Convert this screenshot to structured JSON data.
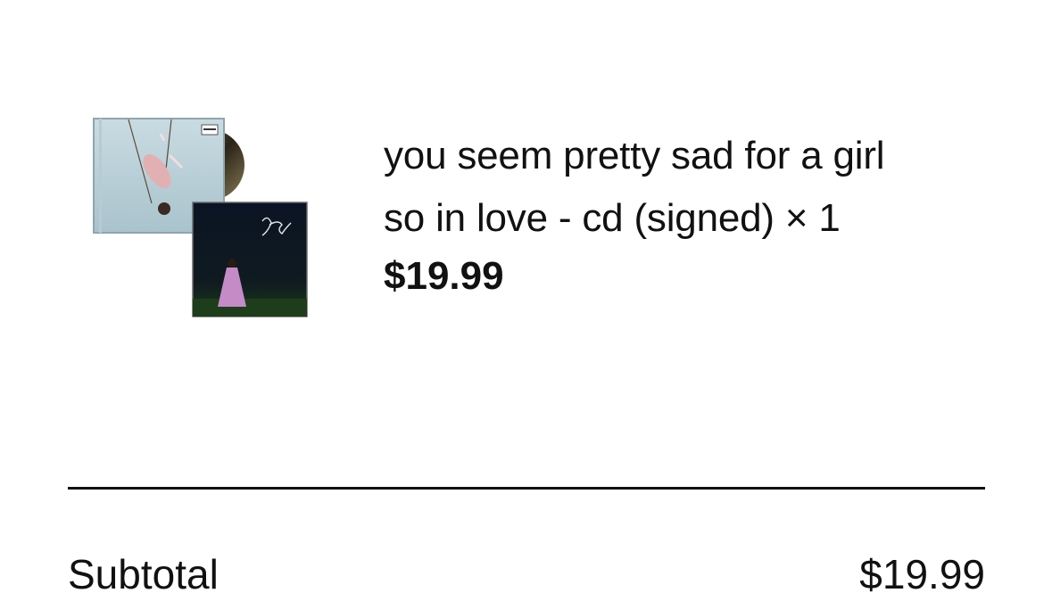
{
  "order": {
    "items": [
      {
        "title": "you seem pretty sad for a girl so in love - cd (signed) × 1",
        "title_line_1": "you seem pretty sad for a girl",
        "title_line_2": "so in love - cd (signed) × 1",
        "price": "$19.99",
        "thumbnail_icon": "album-cover-image"
      }
    ],
    "summary": {
      "subtotal_label": "Subtotal",
      "subtotal_value": "$19.99"
    }
  },
  "colors": {
    "text": "#111111",
    "divider": "#111111",
    "background": "#ffffff"
  }
}
